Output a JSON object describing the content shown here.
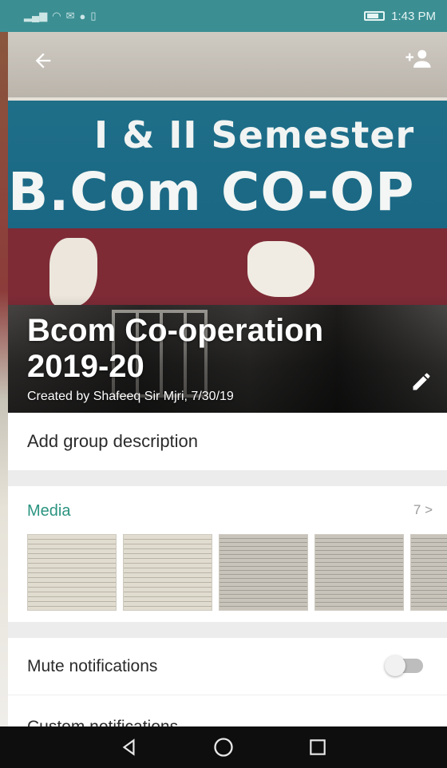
{
  "status_bar": {
    "time": "1:43 PM"
  },
  "header": {
    "banner_line1": "I & II Semester",
    "banner_line2": "B.Com CO-OP",
    "group_name": "Bcom Co-operation 2019-20",
    "created_by": "Created by Shafeeq Sir Mjri, 7/30/19",
    "icons": {
      "back": "arrow-left-icon",
      "add_participant": "add-person-icon",
      "edit": "pencil-icon"
    }
  },
  "description": {
    "placeholder": "Add group description"
  },
  "media": {
    "title": "Media",
    "count": "7",
    "chevron": ">"
  },
  "settings": {
    "mute_label": "Mute notifications",
    "mute_on": false,
    "next_label": "Custom notifications"
  },
  "nav": {
    "icons": [
      "back-triangle-icon",
      "home-circle-icon",
      "recents-square-icon"
    ]
  }
}
